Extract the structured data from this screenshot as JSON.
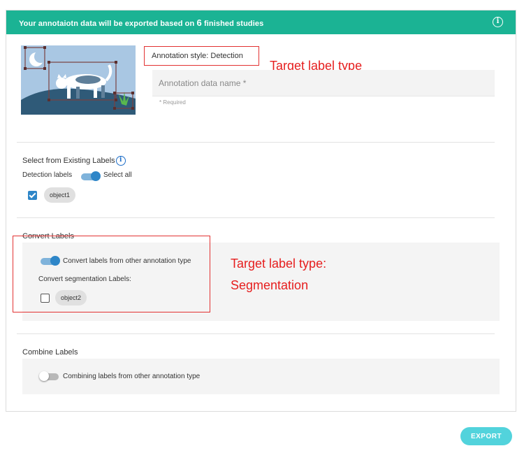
{
  "header": {
    "text_before": "Your annotaiotn data will be exported based on ",
    "count": "6",
    "text_after": " finished studies",
    "info_icon": "info-circle-icon"
  },
  "annotation": {
    "style_label": "Annotation style: Detection",
    "target_note": "Target label type",
    "name_placeholder": "Annotation data name *",
    "name_value": "",
    "required_note": "* Required"
  },
  "existing_labels": {
    "title": "Select from Existing Labels",
    "detection_labels": "Detection labels",
    "select_all": "Select all",
    "select_all_on": true,
    "items": [
      {
        "label": "object1",
        "checked": true
      }
    ]
  },
  "convert": {
    "title": "Convert Labels",
    "toggle_label": "Convert labels from other annotation type",
    "toggle_on": true,
    "sub_title": "Convert segmentation Labels:",
    "items": [
      {
        "label": "object2",
        "checked": false
      }
    ],
    "note_line1": "Target label type:",
    "note_line2": "Segmentation"
  },
  "combine": {
    "title": "Combine Labels",
    "toggle_label": "Combining labels from other annotation type",
    "toggle_on": false
  },
  "footer": {
    "export_label": "EXPORT"
  },
  "colors": {
    "header": "#1bb394",
    "accent": "#2e86c8",
    "annotation_red": "#e61e1e",
    "export_button": "#52d3dc"
  }
}
